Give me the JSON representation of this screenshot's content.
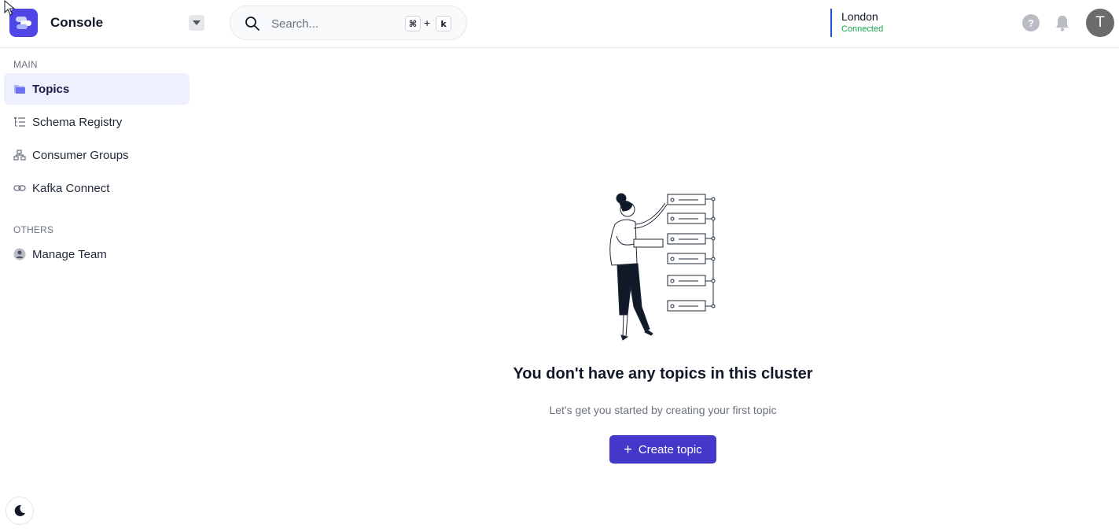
{
  "header": {
    "app_title": "Console",
    "search_placeholder": "Search...",
    "shortcut_cmd": "⌘",
    "shortcut_plus": "+",
    "shortcut_key": "k",
    "cluster_name": "London",
    "cluster_status": "Connected",
    "help_label": "?",
    "avatar_initial": "T"
  },
  "sidebar": {
    "main_label": "MAIN",
    "items": [
      {
        "label": "Topics",
        "icon": "folder-icon",
        "active": true
      },
      {
        "label": "Schema Registry",
        "icon": "schema-tree-icon",
        "active": false
      },
      {
        "label": "Consumer Groups",
        "icon": "hierarchy-icon",
        "active": false
      },
      {
        "label": "Kafka Connect",
        "icon": "link-icon",
        "active": false
      }
    ],
    "others_label": "OTHERS",
    "others_items": [
      {
        "label": "Manage Team",
        "icon": "user-circle-icon"
      }
    ]
  },
  "main": {
    "empty_title": "You don't have any topics in this cluster",
    "empty_subtitle": "Let's get you started by creating your first topic",
    "create_label": "Create topic",
    "create_icon": "+"
  },
  "colors": {
    "accent": "#4338ca",
    "brand": "#4f46e5",
    "active_bg": "#eef0fd",
    "connected": "#16a34a",
    "region_border": "#1d4ed8"
  }
}
